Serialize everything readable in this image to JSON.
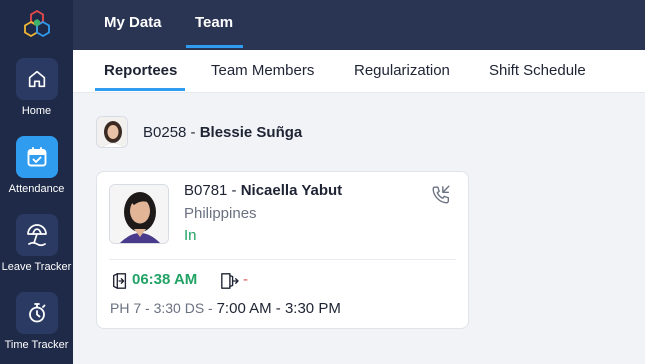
{
  "sidebar": {
    "items": [
      {
        "label": "Home",
        "icon": "home-icon",
        "active": false
      },
      {
        "label": "Attendance",
        "icon": "calendar-check-icon",
        "active": true
      },
      {
        "label": "Leave Tracker",
        "icon": "beach-umbrella-icon",
        "active": false
      },
      {
        "label": "Time Tracker",
        "icon": "stopwatch-icon",
        "active": false
      }
    ]
  },
  "topbar": {
    "tabs": [
      {
        "label": "My Data",
        "active": false
      },
      {
        "label": "Team",
        "active": true
      }
    ]
  },
  "subtabs": [
    {
      "label": "Reportees",
      "active": true
    },
    {
      "label": "Team Members",
      "active": false
    },
    {
      "label": "Regularization",
      "active": false
    },
    {
      "label": "Shift Schedule",
      "active": false
    }
  ],
  "manager": {
    "id": "B0258",
    "separator": " - ",
    "name": "Blessie Suñga"
  },
  "employee": {
    "id": "B0781",
    "separator": " - ",
    "name": "Nicaella Yabut",
    "country": "Philippines",
    "status": "In",
    "check_in": "06:38 AM",
    "check_out": "-",
    "shift_code": "PH 7 - 3:30 DS - ",
    "shift_hours": "7:00 AM - 3:30 PM"
  },
  "colors": {
    "sidebar_bg": "#1f2a48",
    "topbar_bg": "#2a3554",
    "accent": "#2f9cf0",
    "status_in": "#21a366",
    "checkout": "#e05252"
  }
}
